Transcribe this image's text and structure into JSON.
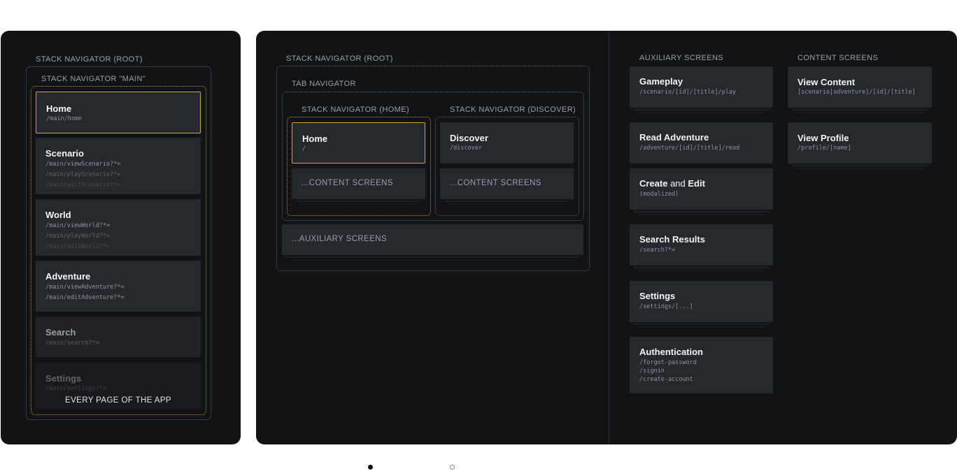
{
  "left": {
    "root_label": "STACK NAVIGATOR (ROOT)",
    "main_label": "STACK NAVIGATOR \"MAIN\"",
    "footer_label": "EVERY PAGE OF THE APP",
    "cards": [
      {
        "title": "Home",
        "routes": [
          "/main/home"
        ]
      },
      {
        "title": "Scenario",
        "routes": [
          "/main/viewScenario?*=",
          "/main/playScenario?*=",
          "/main/editScenario?*="
        ]
      },
      {
        "title": "World",
        "routes": [
          "/main/viewWorld?*=",
          "/main/playWorld?*=",
          "/main/editWorld?*="
        ]
      },
      {
        "title": "Adventure",
        "routes": [
          "/main/viewAdventure?*=",
          "/main/editAdventure?*="
        ]
      },
      {
        "title": "Search",
        "routes": [
          "/main/search?*="
        ]
      },
      {
        "title": "Settings",
        "routes": [
          "/main/settings?*="
        ]
      }
    ]
  },
  "center": {
    "root_label": "STACK NAVIGATOR (ROOT)",
    "tab_label": "TAB NAVIGATOR",
    "home_stack_label": "STACK NAVIGATOR (HOME)",
    "discover_stack_label": "STACK NAVIGATOR (DISCOVER)",
    "home_card": {
      "title": "Home",
      "route": "/"
    },
    "discover_card": {
      "title": "Discover",
      "route": "/discover"
    },
    "content_placeholder": "...CONTENT SCREENS",
    "auxiliary_placeholder": "...AUXILIARY SCREENS"
  },
  "auxiliary": {
    "label": "AUXILIARY SCREENS",
    "cards": [
      {
        "title": "Gameplay",
        "routes": [
          "/scenario/[id]/[title]/play"
        ]
      },
      {
        "title": "Read Adventure",
        "routes": [
          "/adventure/[id]/[title]/read"
        ]
      },
      {
        "title_a": "Create",
        "title_mid": " and ",
        "title_b": "Edit",
        "routes": [
          "(modalized)"
        ]
      },
      {
        "title": "Search Results",
        "routes": [
          "/search?*="
        ]
      },
      {
        "title": "Settings",
        "routes": [
          "/settings/[...]"
        ]
      },
      {
        "title": "Authentication",
        "routes": [
          "/forgot-password",
          "/signin",
          "/create-account"
        ]
      }
    ]
  },
  "content": {
    "label": "CONTENT SCREENS",
    "cards": [
      {
        "title": "View Content",
        "routes": [
          "[scenario|adventure]/[id]/[title]"
        ]
      },
      {
        "title": "View Profile",
        "routes": [
          "/profile/[name]"
        ]
      }
    ]
  },
  "colors": {
    "panel": "#121315",
    "card": "#25282d",
    "highlight": "#d6a236",
    "label": "#9aa0a8"
  },
  "pagination": {
    "active_index": 0,
    "count": 2
  }
}
